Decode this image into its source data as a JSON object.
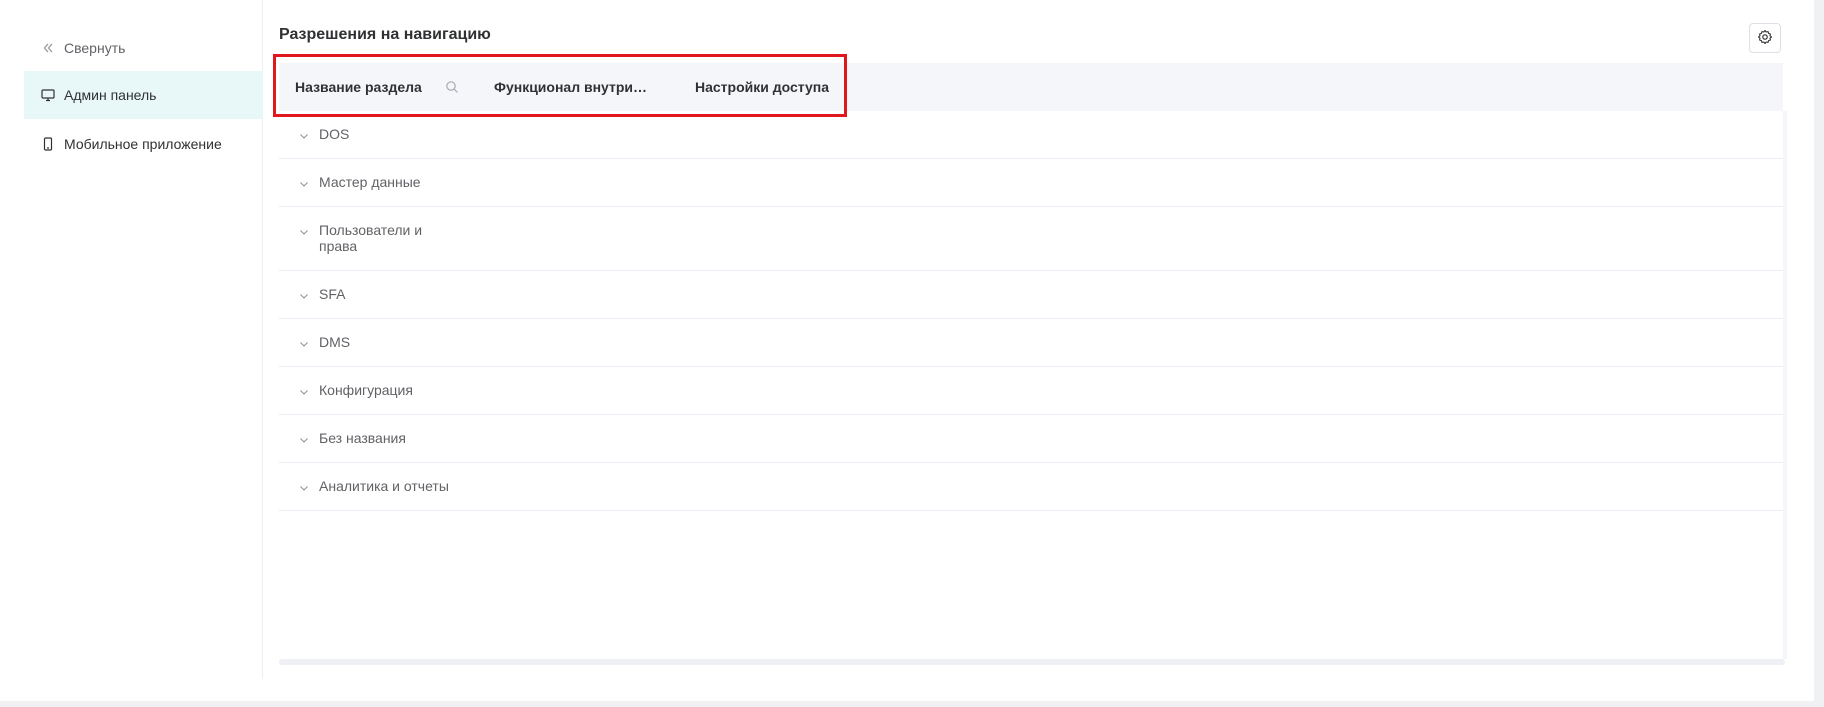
{
  "sidebar": {
    "collapse_label": "Свернуть",
    "items": [
      {
        "label": "Админ панель",
        "icon": "monitor-icon",
        "active": true
      },
      {
        "label": "Мобильное приложение",
        "icon": "phone-icon",
        "active": false
      }
    ]
  },
  "main": {
    "title": "Разрешения на навигацию",
    "settings_icon": "gear-icon",
    "table": {
      "headers": [
        "Название раздела",
        "Функционал внутри р...",
        "Настройки доступа"
      ],
      "rows": [
        {
          "label": "DOS"
        },
        {
          "label": "Мастер данные"
        },
        {
          "label": "Пользователи и права"
        },
        {
          "label": "SFA"
        },
        {
          "label": "DMS"
        },
        {
          "label": "Конфигурация"
        },
        {
          "label": "Без названия"
        },
        {
          "label": "Аналитика и отчеты"
        }
      ]
    }
  },
  "colors": {
    "active_bg": "#e8f8f8",
    "highlight": "#e0181d",
    "header_bg": "#f5f6f9"
  }
}
